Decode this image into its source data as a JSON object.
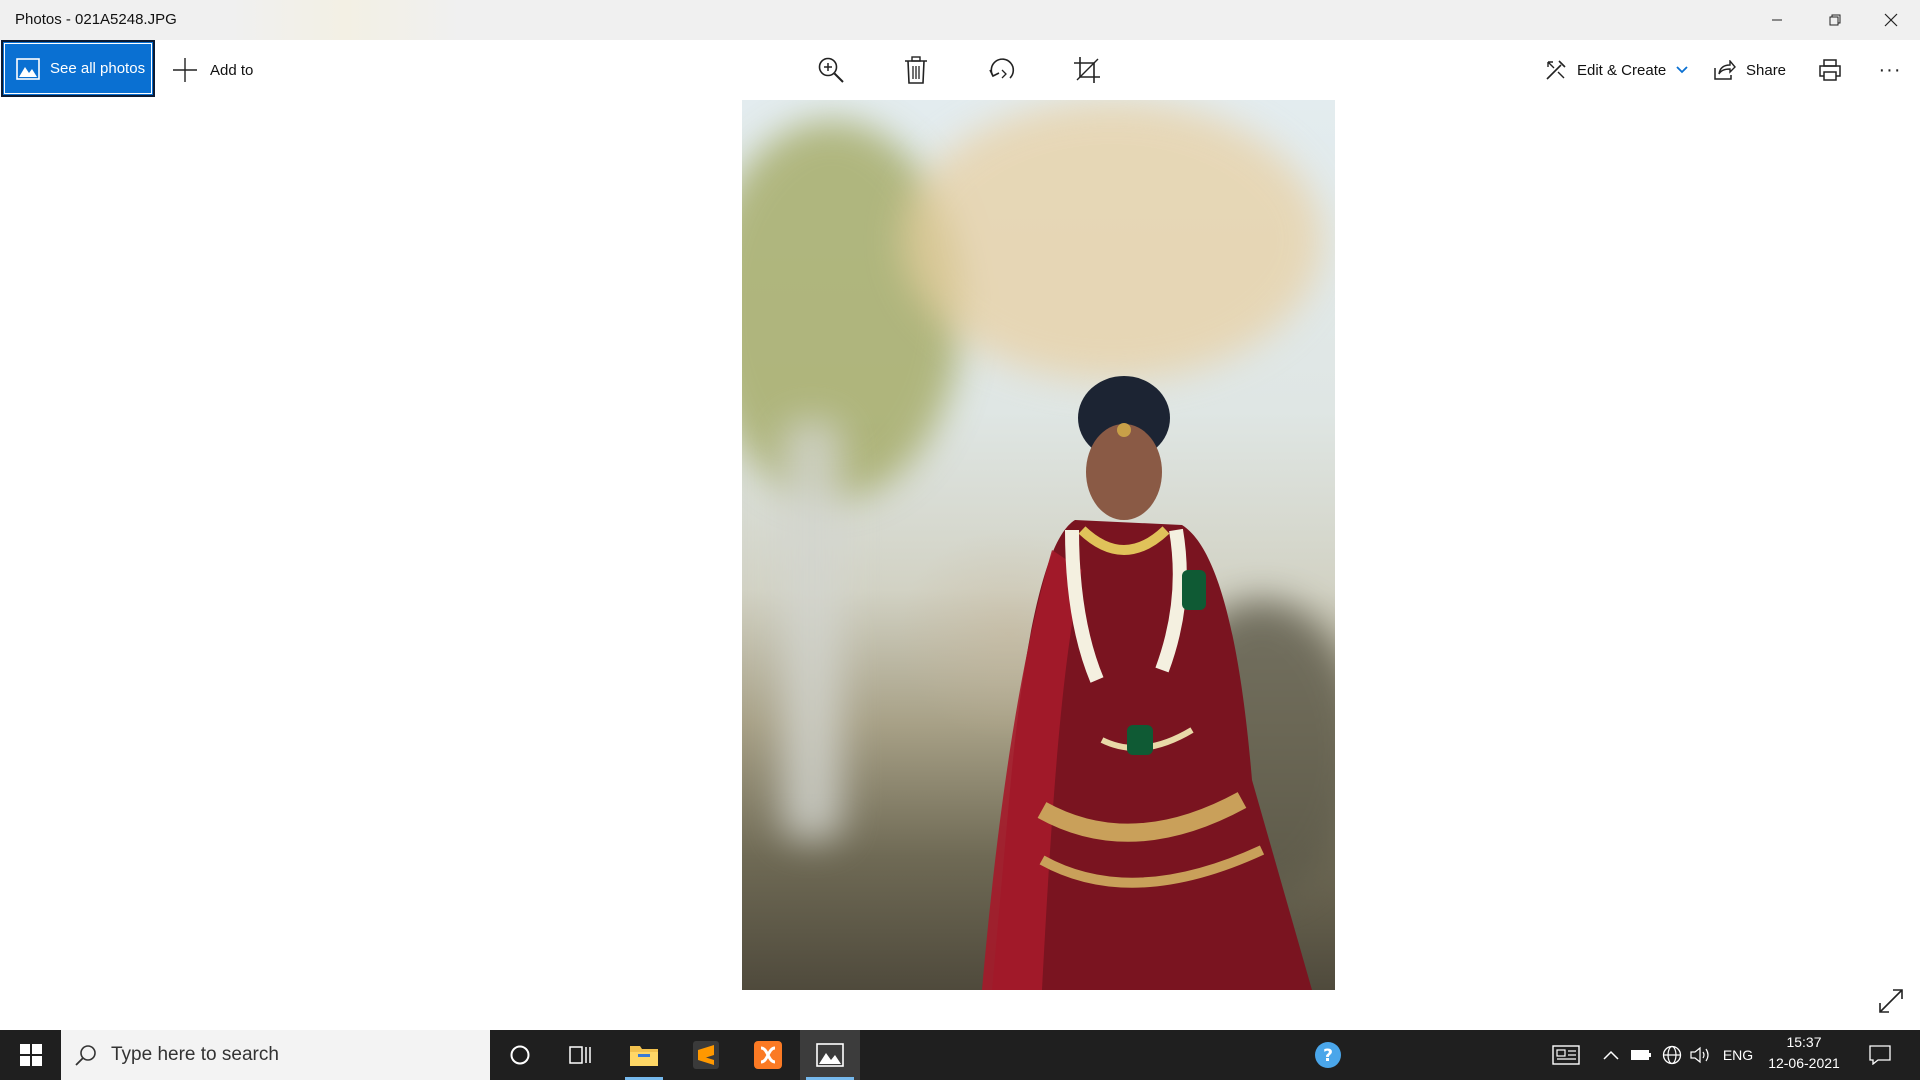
{
  "window": {
    "title": "Photos - 021A5248.JPG",
    "controls": [
      "minimize",
      "restore",
      "close"
    ]
  },
  "toolbar": {
    "see_all_photos": "See all photos",
    "add_to": "Add to",
    "edit_create": "Edit & Create",
    "share": "Share",
    "more": "···",
    "center_tools": [
      "zoom-icon",
      "delete-icon",
      "rotate-icon",
      "crop-icon"
    ]
  },
  "taskbar": {
    "search_placeholder": "Type here to search",
    "language": "ENG",
    "time": "15:37",
    "date": "12-06-2021",
    "pinned_apps": [
      "cortana",
      "task-view",
      "file-explorer",
      "sublime-text",
      "xampp",
      "photos"
    ]
  },
  "colors": {
    "accent": "#0a70d2",
    "taskbar_bg": "#1f1f1f",
    "active_indicator": "#76b9ed"
  }
}
